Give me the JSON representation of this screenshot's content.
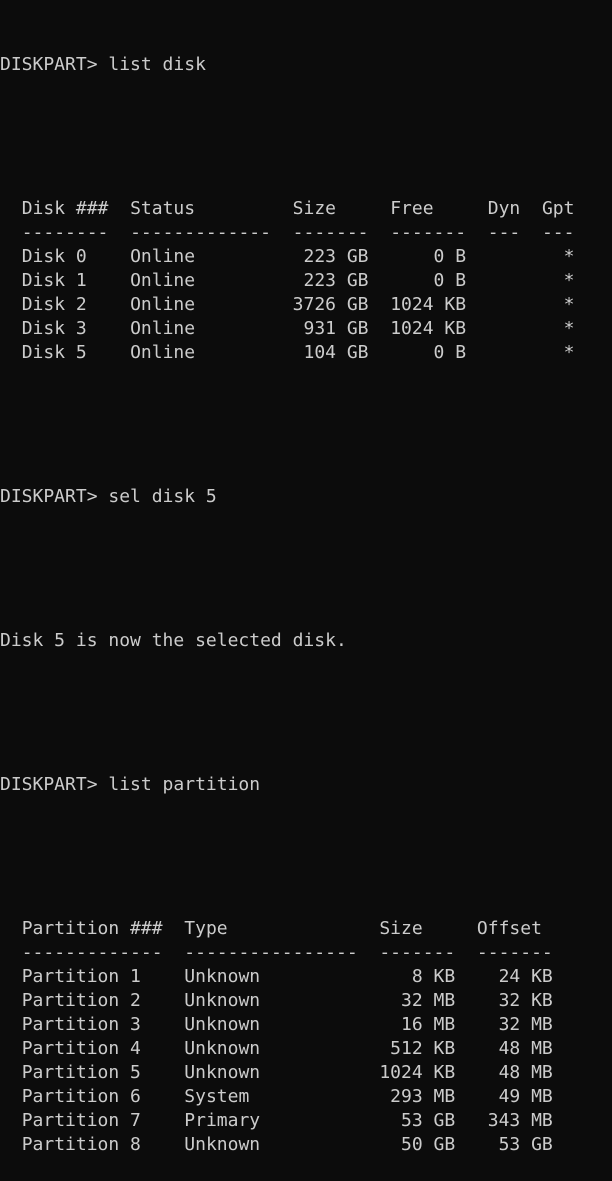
{
  "terminal": {
    "prompt": "DISKPART> ",
    "commands": [
      "list disk",
      "sel disk 5",
      "list partition"
    ],
    "messages": [
      "Disk 5 is now the selected disk."
    ]
  },
  "disk_table": {
    "headers": [
      "Disk ###",
      "Status",
      "Size",
      "Free",
      "Dyn",
      "Gpt"
    ],
    "rows": [
      [
        "Disk 0",
        "Online",
        "223 GB",
        "0 B",
        "",
        "*"
      ],
      [
        "Disk 1",
        "Online",
        "223 GB",
        "0 B",
        "",
        "*"
      ],
      [
        "Disk 2",
        "Online",
        "3726 GB",
        "1024 KB",
        "",
        "*"
      ],
      [
        "Disk 3",
        "Online",
        "931 GB",
        "1024 KB",
        "",
        "*"
      ],
      [
        "Disk 5",
        "Online",
        "104 GB",
        "0 B",
        "",
        "*"
      ]
    ]
  },
  "partition_table": {
    "headers": [
      "Partition ###",
      "Type",
      "Size",
      "Offset"
    ],
    "rows": [
      [
        "Partition 1",
        "Unknown",
        "8 KB",
        "24 KB"
      ],
      [
        "Partition 2",
        "Unknown",
        "32 MB",
        "32 KB"
      ],
      [
        "Partition 3",
        "Unknown",
        "16 MB",
        "32 MB"
      ],
      [
        "Partition 4",
        "Unknown",
        "512 KB",
        "48 MB"
      ],
      [
        "Partition 5",
        "Unknown",
        "1024 KB",
        "48 MB"
      ],
      [
        "Partition 6",
        "System",
        "293 MB",
        "49 MB"
      ],
      [
        "Partition 7",
        "Primary",
        "53 GB",
        "343 MB"
      ],
      [
        "Partition 8",
        "Unknown",
        "50 GB",
        "53 GB"
      ]
    ]
  }
}
